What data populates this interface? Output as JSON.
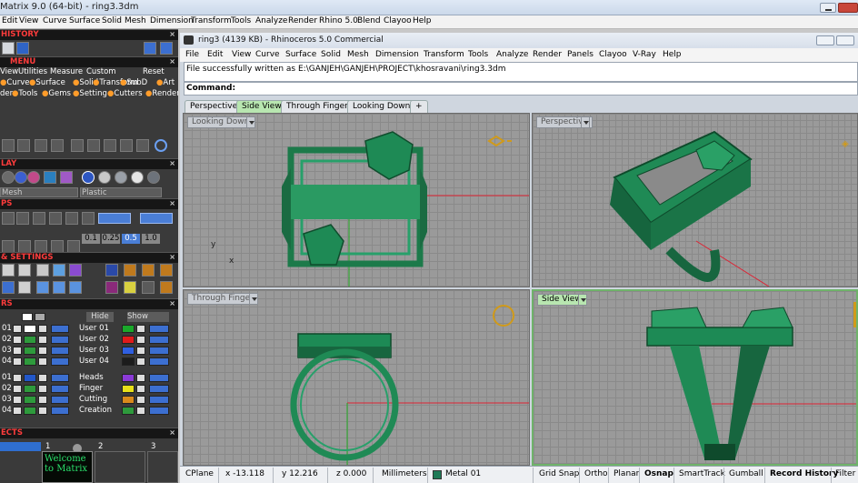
{
  "outer": {
    "title": "Matrix 9.0 (64-bit) - ring3.3dm",
    "menu": [
      "Edit",
      "View",
      "Curve",
      "Surface",
      "Solid",
      "Mesh",
      "Dimension",
      "Transform",
      "Tools",
      "Analyze",
      "Render",
      "Rhino 5.0",
      "Blend",
      "Clayoo",
      "Help"
    ]
  },
  "left": {
    "history_label": "HISTORY",
    "menu_label": "MENU",
    "menu_row1": [
      "View",
      "Utilities",
      "Measure",
      "Custom",
      "Reset"
    ],
    "menu_row2": [
      "Curve",
      "Surface",
      "Solid",
      "Transform",
      "SubD",
      "Art"
    ],
    "menu_row3": [
      "der",
      "Tools",
      "Gems",
      "Setting",
      "Cutters",
      "Render"
    ],
    "display_label": "LAY",
    "display_dropdowns": [
      "Mesh",
      "Plastic"
    ],
    "snaps_label": "PS",
    "snap_values": [
      "0.1",
      "0.25",
      "0.5",
      "1.0"
    ],
    "settings_label": "& SETTINGS",
    "layers_label": "RS",
    "layers_hide": "Hide",
    "layers_show": "Show",
    "layers_left": [
      "01",
      "02",
      "03",
      "04",
      "01",
      "02",
      "03",
      "04"
    ],
    "layers_right": [
      "User 01",
      "User 02",
      "User 03",
      "User 04",
      "Heads",
      "Finger",
      "Cutting",
      "Creation"
    ],
    "layer_colors_left": [
      "#ffffff",
      "#2e9a3c",
      "#2e9a3c",
      "#2e9a3c",
      "#2257c9",
      "#2e9a3c",
      "#2e9a3c",
      "#2e9a3c"
    ],
    "layer_colors_right": [
      "#1aa82a",
      "#e01b1b",
      "#2f5fe0",
      "#1c1c1c",
      "#8b3ad6",
      "#e8e019",
      "#d98a1c",
      "#2e9a3c"
    ],
    "objects_label": "ECTS",
    "objects_numbers": [
      "1",
      "2",
      "3"
    ],
    "welcome_text": "Welcome to Matrix"
  },
  "rhino": {
    "title": "ring3 (4139 KB) - Rhinoceros 5.0 Commercial",
    "menu": [
      "File",
      "Edit",
      "View",
      "Curve",
      "Surface",
      "Solid",
      "Mesh",
      "Dimension",
      "Transform",
      "Tools",
      "Analyze",
      "Render",
      "Panels",
      "Clayoo",
      "V-Ray",
      "Help"
    ],
    "history_line": "File successfully written as E:\\GANJEH\\GANJEH\\PROJECT\\khosravani\\ring3.3dm",
    "command_label": "Command:",
    "tabs": [
      "Perspective",
      "Side View",
      "Through Finger",
      "Looking Down",
      "+"
    ],
    "active_tab": "Side View",
    "viewports": [
      "Looking Down",
      "Perspective",
      "Through Finger",
      "Side View"
    ],
    "active_viewport": "Side View",
    "axis_x": "x",
    "axis_y": "y"
  },
  "status": {
    "cplane": "CPlane",
    "x": "x -13.118",
    "y": "y 12.216",
    "z": "z 0.000",
    "units": "Millimeters",
    "layer": "Metal 01",
    "layer_color": "#1f7a57",
    "toggles": [
      "Grid Snap",
      "Ortho",
      "Planar",
      "Osnap",
      "SmartTrack",
      "Gumball",
      "Record History",
      "Filter"
    ],
    "bold_toggles": [
      "Osnap",
      "Record History"
    ]
  }
}
